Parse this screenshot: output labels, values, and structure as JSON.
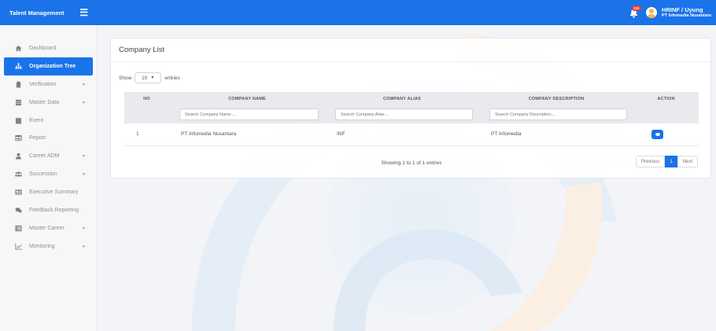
{
  "app": {
    "title": "Talent Management"
  },
  "header": {
    "badge": "100",
    "user_name": "HRINF / Uyung",
    "user_company": "PT Infomedia Nusantara"
  },
  "sidebar": {
    "items": [
      {
        "label": "Dashboard",
        "icon": "home-icon",
        "caret": false
      },
      {
        "label": "Organization Tree",
        "icon": "sitemap-icon",
        "caret": false,
        "active": true
      },
      {
        "label": "Verification",
        "icon": "clipboard-icon",
        "caret": true
      },
      {
        "label": "Master Data",
        "icon": "database-icon",
        "caret": true
      },
      {
        "label": "Event",
        "icon": "calendar-icon",
        "caret": false
      },
      {
        "label": "Report",
        "icon": "table-icon",
        "caret": false
      },
      {
        "label": "Career ADM",
        "icon": "user-icon",
        "caret": true
      },
      {
        "label": "Succession",
        "icon": "users-icon",
        "caret": true
      },
      {
        "label": "Executive Summary",
        "icon": "id-card-icon",
        "caret": false
      },
      {
        "label": "Feedback Reporting",
        "icon": "comments-icon",
        "caret": false
      },
      {
        "label": "Master Career",
        "icon": "list-alt-icon",
        "caret": true
      },
      {
        "label": "Monitoring",
        "icon": "line-chart-icon",
        "caret": true
      }
    ]
  },
  "main": {
    "card_title": "Company List",
    "show_label": "Show",
    "entries_value": "10",
    "entries_label": "entries",
    "table": {
      "columns": [
        "NO",
        "COMPANY NAME",
        "COMPANY ALIAS",
        "COMPANY DESCRIPTION",
        "ACTION"
      ],
      "filters": {
        "name_placeholder": "Search Company Name ...",
        "alias_placeholder": "Search Company Alias ...",
        "desc_placeholder": "Search Company Description..."
      },
      "rows": [
        {
          "no": "1",
          "name": "PT Infomedia Nusantara",
          "alias": "INF",
          "description": "PT Infomedia"
        }
      ]
    },
    "showing_text": "Showing 1 to 1 of 1 entries",
    "pagination": {
      "previous": "Previous",
      "current": "1",
      "next": "Next"
    }
  },
  "colors": {
    "primary": "#1a73e8",
    "watermark_blue": "#d6e6f3",
    "watermark_orange": "#fbe9d6"
  }
}
